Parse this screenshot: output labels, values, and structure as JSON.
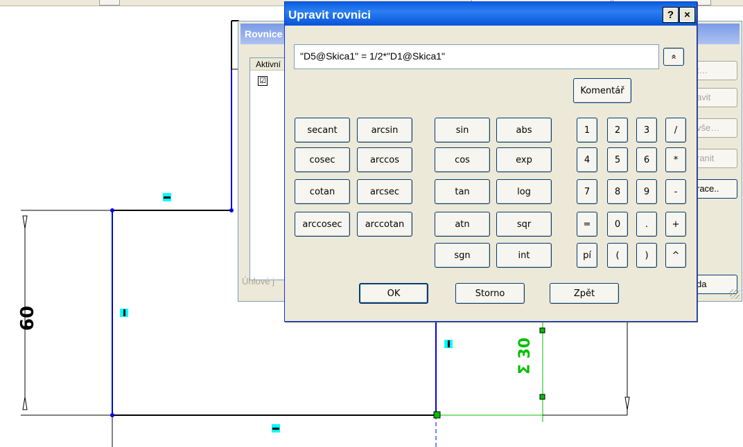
{
  "editor": {
    "title": "Upravit rovnici",
    "help_label": "?",
    "close_label": "×",
    "equation_value": "\"D5@Skica1\" = 1/2*\"D1@Skica1\"",
    "expand_label": "»",
    "comment_label": "Komentář",
    "func_col1": [
      "secant",
      "cosec",
      "cotan",
      "arccosec"
    ],
    "func_col2": [
      "arcsin",
      "arccos",
      "arcsec",
      "arccotan"
    ],
    "func_col3": [
      "sin",
      "cos",
      "tan",
      "atn",
      "sgn"
    ],
    "func_col4": [
      "abs",
      "exp",
      "log",
      "sqr",
      "int"
    ],
    "keypad_rows": [
      [
        "1",
        "2",
        "3",
        "/"
      ],
      [
        "4",
        "5",
        "6",
        "*"
      ],
      [
        "7",
        "8",
        "9",
        "-"
      ],
      [
        "=",
        "0",
        ".",
        "+"
      ],
      [
        "pí",
        "(",
        ")",
        "^"
      ]
    ],
    "ok_label": "OK",
    "cancel_label": "Storno",
    "back_label": "Zpět"
  },
  "equations_dialog": {
    "title": "Rovnice",
    "column_header": "Aktivní",
    "active_checked": "☑",
    "angle_label": "Úhlové j",
    "side_buttons": [
      "t…",
      "avit",
      "vše…",
      "ranit",
      "race..",
      "da"
    ]
  },
  "sketch": {
    "dimension_60": "60",
    "dimension_30": "Σ 30",
    "colors": {
      "line": "#0000e0",
      "driven": "#00c000",
      "marker": "#00ffff"
    }
  }
}
